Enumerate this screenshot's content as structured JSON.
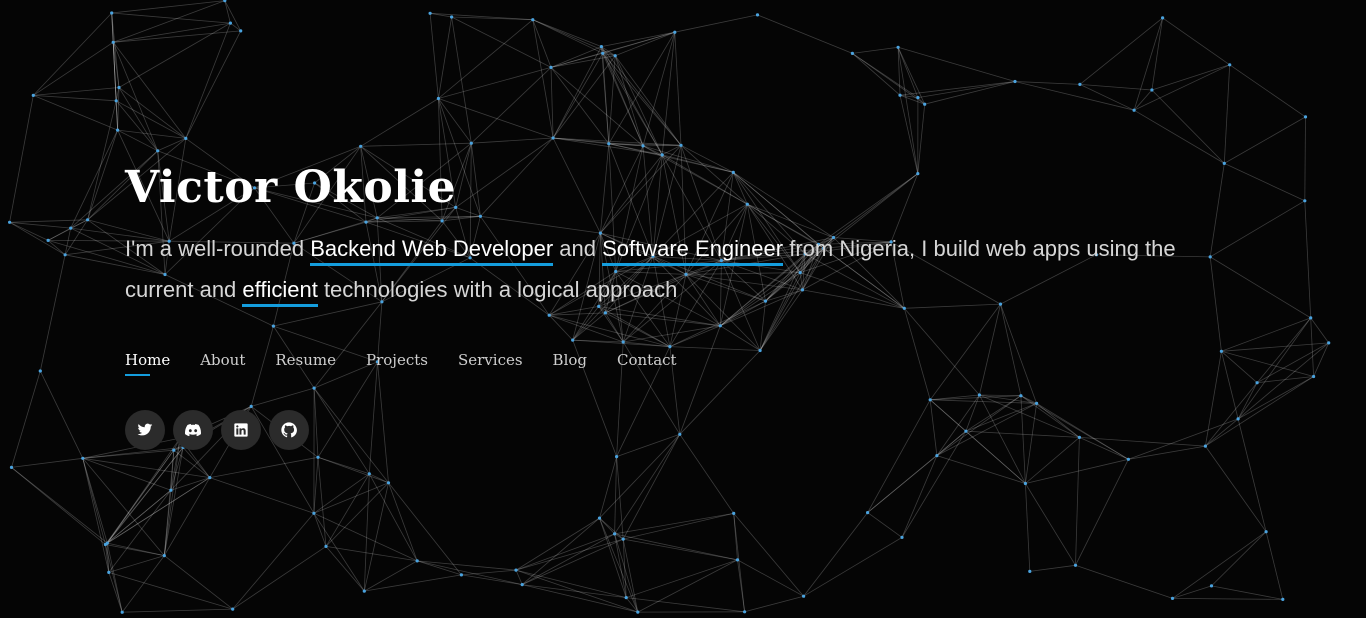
{
  "hero": {
    "name": "Victor Okolie",
    "tagline": {
      "t1": "I'm a well-rounded ",
      "h1": "Backend Web Developer",
      "t2": " and ",
      "h2": "Software Engineer",
      "t3": " from Nigeria, I build web apps using the current and ",
      "h3": "efficient",
      "t4": " technologies with a logical approach"
    }
  },
  "nav": {
    "items": [
      {
        "label": "Home",
        "active": true
      },
      {
        "label": "About"
      },
      {
        "label": "Resume"
      },
      {
        "label": "Projects"
      },
      {
        "label": "Services"
      },
      {
        "label": "Blog"
      },
      {
        "label": "Contact"
      }
    ]
  },
  "social": [
    {
      "icon": "twitter-icon"
    },
    {
      "icon": "discord-icon"
    },
    {
      "icon": "linkedin-icon"
    },
    {
      "icon": "github-icon"
    }
  ],
  "colors": {
    "background": "#050505",
    "accent": "#149ddd",
    "node": "#4aa3df"
  }
}
